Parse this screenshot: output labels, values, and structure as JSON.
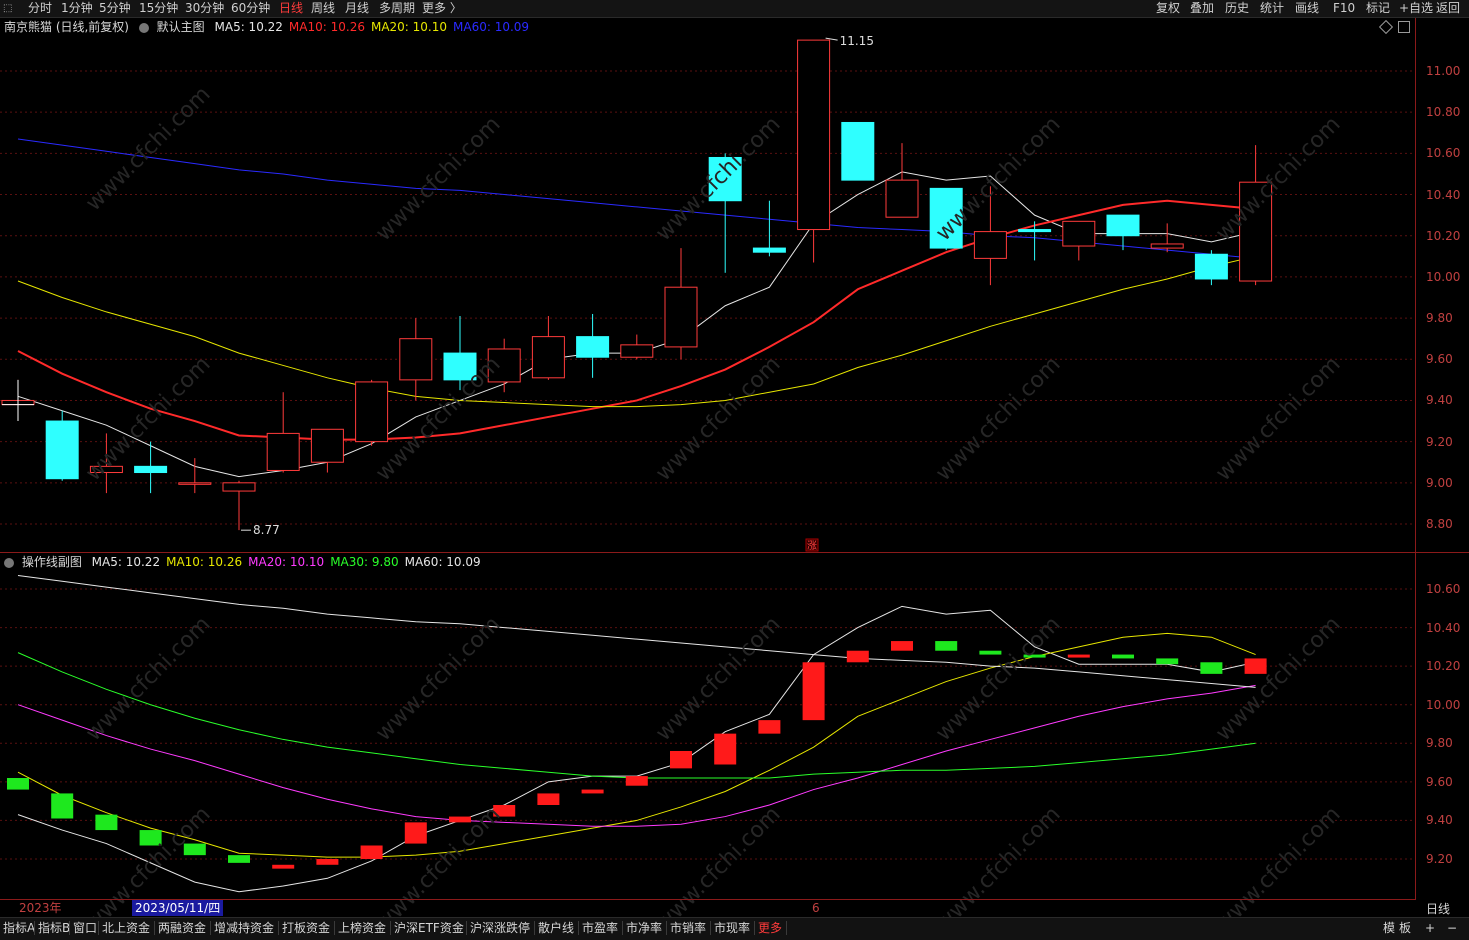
{
  "topbar": {
    "menu_glyph": "⬚",
    "periods": [
      "分时",
      "1分钟",
      "5分钟",
      "15分钟",
      "30分钟",
      "60分钟",
      "日线",
      "周线",
      "月线",
      "多周期",
      "更多 〉"
    ],
    "active_period": "日线",
    "right_buttons": [
      "复权",
      "叠加",
      "历史",
      "统计",
      "画线",
      "F10",
      "标记",
      "+自选",
      "返回"
    ]
  },
  "main_panel": {
    "stock_name": "南京熊猫 (日线,前复权)",
    "template": "默认主图",
    "ma_legend": [
      {
        "label": "MA5: 10.22",
        "color": "#e6e6e6"
      },
      {
        "label": "MA10: 10.26",
        "color": "#ff2a2a"
      },
      {
        "label": "MA20: 10.10",
        "color": "#e6e600"
      },
      {
        "label": "MA60: 10.09",
        "color": "#2a2aff"
      }
    ],
    "price_axis": [
      "11.00",
      "10.80",
      "10.60",
      "10.40",
      "10.20",
      "10.00",
      "9.80",
      "9.60",
      "9.40",
      "9.20",
      "9.00",
      "8.80"
    ],
    "high_mark": "11.15",
    "low_mark": "8.77",
    "zhang_marker": "涨"
  },
  "sub_panel": {
    "title": "操作线副图",
    "ma_legend": [
      {
        "label": "MA5: 10.22",
        "color": "#e6e6e6"
      },
      {
        "label": "MA10: 10.26",
        "color": "#e6e600"
      },
      {
        "label": "MA20: 10.10",
        "color": "#ff3bff"
      },
      {
        "label": "MA30: 9.80",
        "color": "#2aff2a"
      },
      {
        "label": "MA60: 10.09",
        "color": "#e6e6e6"
      }
    ],
    "price_axis": [
      "10.60",
      "10.40",
      "10.20",
      "10.00",
      "9.80",
      "9.60",
      "9.40",
      "9.20"
    ]
  },
  "date_axis": {
    "year_label": "2023年",
    "cursor_date": "2023/05/11/四",
    "month_label": "6",
    "period_label": "日线"
  },
  "bottom_tabs": [
    "指标A",
    "指标B",
    "窗口",
    "北上资金",
    "两融资金",
    "增减持资金",
    "打板资金",
    "上榜资金",
    "沪深ETF资金",
    "沪深涨跌停",
    "散户线",
    "市盈率",
    "市净率",
    "市销率",
    "市现率",
    "更多"
  ],
  "bottom_right": [
    "模",
    "板",
    "+",
    "−"
  ],
  "chart_data": {
    "type": "candlestick",
    "ylim": [
      8.72,
      11.18
    ],
    "candles": [
      {
        "o": 9.38,
        "c": 9.4,
        "h": 9.5,
        "l": 9.3
      },
      {
        "o": 9.3,
        "c": 9.02,
        "h": 9.35,
        "l": 9.01
      },
      {
        "o": 9.05,
        "c": 9.08,
        "h": 9.24,
        "l": 8.95
      },
      {
        "o": 9.08,
        "c": 9.05,
        "h": 9.2,
        "l": 8.95
      },
      {
        "o": 9.0,
        "c": 9.0,
        "h": 9.12,
        "l": 8.95
      },
      {
        "o": 8.96,
        "c": 9.0,
        "h": 9.01,
        "l": 8.77
      },
      {
        "o": 9.06,
        "c": 9.24,
        "h": 9.44,
        "l": 9.05
      },
      {
        "o": 9.1,
        "c": 9.26,
        "h": 9.26,
        "l": 9.05
      },
      {
        "o": 9.2,
        "c": 9.49,
        "h": 9.5,
        "l": 9.18
      },
      {
        "o": 9.5,
        "c": 9.7,
        "h": 9.8,
        "l": 9.4
      },
      {
        "o": 9.63,
        "c": 9.5,
        "h": 9.81,
        "l": 9.45
      },
      {
        "o": 9.49,
        "c": 9.65,
        "h": 9.7,
        "l": 9.44
      },
      {
        "o": 9.51,
        "c": 9.71,
        "h": 9.81,
        "l": 9.5
      },
      {
        "o": 9.71,
        "c": 9.61,
        "h": 9.82,
        "l": 9.51
      },
      {
        "o": 9.61,
        "c": 9.67,
        "h": 9.72,
        "l": 9.6
      },
      {
        "o": 9.66,
        "c": 9.95,
        "h": 10.14,
        "l": 9.6
      },
      {
        "o": 10.58,
        "c": 10.37,
        "h": 10.6,
        "l": 10.02
      },
      {
        "o": 10.14,
        "c": 10.12,
        "h": 10.37,
        "l": 10.1
      },
      {
        "o": 10.23,
        "c": 11.15,
        "h": 11.15,
        "l": 10.07
      },
      {
        "o": 10.75,
        "c": 10.47,
        "h": 10.75,
        "l": 10.47
      },
      {
        "o": 10.29,
        "c": 10.47,
        "h": 10.65,
        "l": 10.29
      },
      {
        "o": 10.43,
        "c": 10.14,
        "h": 10.43,
        "l": 10.13
      },
      {
        "o": 10.09,
        "c": 10.22,
        "h": 10.44,
        "l": 9.96
      },
      {
        "o": 10.23,
        "c": 10.22,
        "h": 10.27,
        "l": 10.08
      },
      {
        "o": 10.15,
        "c": 10.27,
        "h": 10.27,
        "l": 10.08
      },
      {
        "o": 10.3,
        "c": 10.2,
        "h": 10.3,
        "l": 10.13
      },
      {
        "o": 10.14,
        "c": 10.16,
        "h": 10.26,
        "l": 10.12
      },
      {
        "o": 10.11,
        "c": 9.99,
        "h": 10.13,
        "l": 9.96
      },
      {
        "o": 9.98,
        "c": 10.46,
        "h": 10.64,
        "l": 9.96
      }
    ],
    "series": [
      {
        "name": "MA5",
        "color": "#e6e6e6",
        "values": [
          9.42,
          9.35,
          9.28,
          9.18,
          9.08,
          9.03,
          9.06,
          9.1,
          9.19,
          9.32,
          9.4,
          9.48,
          9.6,
          9.63,
          9.63,
          9.7,
          9.86,
          9.95,
          10.26,
          10.4,
          10.51,
          10.47,
          10.49,
          10.3,
          10.21,
          10.21,
          10.21,
          10.17,
          10.22
        ]
      },
      {
        "name": "MA10",
        "color": "#ff2a2a",
        "values": [
          9.64,
          9.53,
          9.44,
          9.36,
          9.3,
          9.23,
          9.22,
          9.21,
          9.21,
          9.22,
          9.24,
          9.28,
          9.32,
          9.36,
          9.4,
          9.47,
          9.55,
          9.66,
          9.78,
          9.94,
          10.03,
          10.12,
          10.19,
          10.25,
          10.3,
          10.35,
          10.37,
          10.35,
          10.33
        ]
      },
      {
        "name": "MA20",
        "color": "#e6e600",
        "values": [
          9.98,
          9.9,
          9.83,
          9.77,
          9.71,
          9.63,
          9.57,
          9.51,
          9.46,
          9.42,
          9.4,
          9.39,
          9.38,
          9.37,
          9.37,
          9.38,
          9.4,
          9.44,
          9.48,
          9.56,
          9.62,
          9.69,
          9.76,
          9.82,
          9.88,
          9.94,
          9.99,
          10.05,
          10.1
        ]
      },
      {
        "name": "MA60",
        "color": "#2a2aff",
        "values": [
          10.67,
          10.64,
          10.61,
          10.58,
          10.55,
          10.52,
          10.5,
          10.47,
          10.45,
          10.43,
          10.42,
          10.4,
          10.38,
          10.36,
          10.34,
          10.32,
          10.3,
          10.28,
          10.26,
          10.24,
          10.23,
          10.22,
          10.2,
          10.19,
          10.17,
          10.15,
          10.13,
          10.11,
          10.09
        ]
      }
    ],
    "sub": {
      "ylim": [
        9.08,
        10.78
      ],
      "bars": [
        {
          "t": 9.62,
          "b": 9.56,
          "c": "#1ee81e"
        },
        {
          "t": 9.54,
          "b": 9.41,
          "c": "#1ee81e"
        },
        {
          "t": 9.43,
          "b": 9.35,
          "c": "#1ee81e"
        },
        {
          "t": 9.35,
          "b": 9.27,
          "c": "#1ee81e"
        },
        {
          "t": 9.28,
          "b": 9.22,
          "c": "#1ee81e"
        },
        {
          "t": 9.22,
          "b": 9.18,
          "c": "#1ee81e"
        },
        {
          "t": 9.17,
          "b": 9.15,
          "c": "#ff1a1a"
        },
        {
          "t": 9.2,
          "b": 9.17,
          "c": "#ff1a1a"
        },
        {
          "t": 9.27,
          "b": 9.2,
          "c": "#ff1a1a"
        },
        {
          "t": 9.39,
          "b": 9.28,
          "c": "#ff1a1a"
        },
        {
          "t": 9.42,
          "b": 9.39,
          "c": "#ff1a1a"
        },
        {
          "t": 9.48,
          "b": 9.42,
          "c": "#ff1a1a"
        },
        {
          "t": 9.54,
          "b": 9.48,
          "c": "#ff1a1a"
        },
        {
          "t": 9.56,
          "b": 9.54,
          "c": "#ff1a1a"
        },
        {
          "t": 9.63,
          "b": 9.58,
          "c": "#ff1a1a"
        },
        {
          "t": 9.76,
          "b": 9.67,
          "c": "#ff1a1a"
        },
        {
          "t": 9.85,
          "b": 9.69,
          "c": "#ff1a1a"
        },
        {
          "t": 9.92,
          "b": 9.85,
          "c": "#ff1a1a"
        },
        {
          "t": 10.22,
          "b": 9.92,
          "c": "#ff1a1a"
        },
        {
          "t": 10.28,
          "b": 10.22,
          "c": "#ff1a1a"
        },
        {
          "t": 10.33,
          "b": 10.28,
          "c": "#ff1a1a"
        },
        {
          "t": 10.33,
          "b": 10.28,
          "c": "#1ee81e"
        },
        {
          "t": 10.28,
          "b": 10.26,
          "c": "#1ee81e"
        },
        {
          "t": 10.26,
          "b": 10.25,
          "c": "#1ee81e"
        },
        {
          "t": 10.26,
          "b": 10.25,
          "c": "#ff1a1a"
        },
        {
          "t": 10.26,
          "b": 10.24,
          "c": "#1ee81e"
        },
        {
          "t": 10.24,
          "b": 10.21,
          "c": "#1ee81e"
        },
        {
          "t": 10.22,
          "b": 10.16,
          "c": "#1ee81e"
        },
        {
          "t": 10.24,
          "b": 10.16,
          "c": "#ff1a1a"
        }
      ],
      "lines": [
        {
          "name": "MA5",
          "color": "#e6e6e6",
          "values": [
            9.43,
            9.35,
            9.28,
            9.18,
            9.08,
            9.03,
            9.06,
            9.1,
            9.19,
            9.32,
            9.4,
            9.48,
            9.6,
            9.63,
            9.63,
            9.7,
            9.86,
            9.95,
            10.26,
            10.4,
            10.51,
            10.47,
            10.49,
            10.3,
            10.21,
            10.21,
            10.21,
            10.17,
            10.22
          ]
        },
        {
          "name": "MA10",
          "color": "#e6e600",
          "values": [
            9.65,
            9.53,
            9.44,
            9.36,
            9.3,
            9.23,
            9.22,
            9.21,
            9.21,
            9.22,
            9.24,
            9.28,
            9.32,
            9.36,
            9.4,
            9.47,
            9.55,
            9.66,
            9.78,
            9.94,
            10.03,
            10.12,
            10.19,
            10.25,
            10.3,
            10.35,
            10.37,
            10.35,
            10.26
          ]
        },
        {
          "name": "MA20",
          "color": "#ff3bff",
          "values": [
            10.0,
            9.92,
            9.84,
            9.77,
            9.71,
            9.64,
            9.57,
            9.51,
            9.46,
            9.42,
            9.4,
            9.39,
            9.38,
            9.37,
            9.37,
            9.38,
            9.42,
            9.48,
            9.56,
            9.62,
            9.69,
            9.76,
            9.82,
            9.88,
            9.94,
            9.99,
            10.03,
            10.06,
            10.1
          ]
        },
        {
          "name": "MA30",
          "color": "#2aff2a",
          "values": [
            10.27,
            10.17,
            10.08,
            10.0,
            9.93,
            9.87,
            9.82,
            9.78,
            9.75,
            9.72,
            9.69,
            9.67,
            9.65,
            9.63,
            9.62,
            9.62,
            9.62,
            9.62,
            9.64,
            9.65,
            9.66,
            9.66,
            9.67,
            9.68,
            9.7,
            9.72,
            9.74,
            9.77,
            9.8
          ]
        },
        {
          "name": "MA60",
          "color": "#e6e6e6",
          "values": [
            10.67,
            10.64,
            10.61,
            10.58,
            10.55,
            10.52,
            10.5,
            10.47,
            10.45,
            10.43,
            10.42,
            10.4,
            10.38,
            10.36,
            10.34,
            10.32,
            10.3,
            10.28,
            10.26,
            10.24,
            10.23,
            10.22,
            10.2,
            10.19,
            10.17,
            10.15,
            10.13,
            10.11,
            10.09
          ]
        }
      ]
    }
  }
}
